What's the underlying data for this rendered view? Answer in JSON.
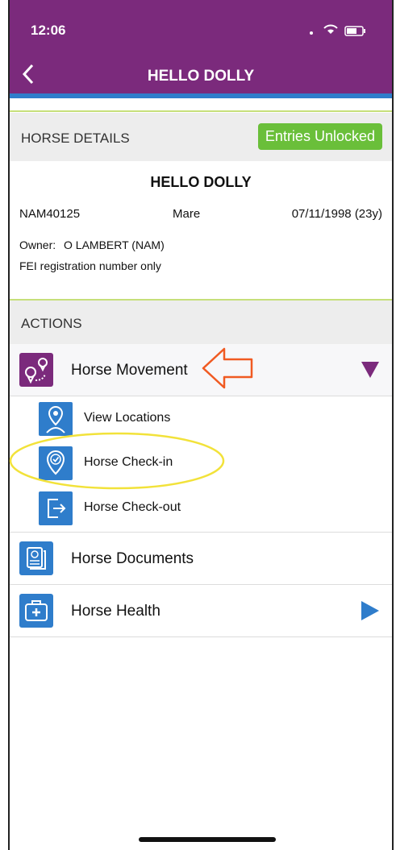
{
  "status": {
    "time": "12:06"
  },
  "nav": {
    "title": "HELLO DOLLY"
  },
  "details": {
    "section_label": "HORSE DETAILS",
    "badge": "Entries Unlocked",
    "horse_name": "HELLO DOLLY",
    "fei_id": "NAM40125",
    "sex": "Mare",
    "dob": "07/11/1998 (23y)",
    "owner_prefix": "Owner:",
    "owner": "O LAMBERT (NAM)",
    "registration_note": "FEI registration number only"
  },
  "actions": {
    "section_label": "ACTIONS",
    "movement": {
      "label": "Horse Movement",
      "icon": "location-route-icon",
      "sub_items": [
        {
          "label": "View Locations",
          "icon": "map-marker-person-icon"
        },
        {
          "label": "Horse Check-in",
          "icon": "location-check-icon"
        },
        {
          "label": "Horse Check-out",
          "icon": "exit-door-icon"
        }
      ]
    },
    "documents": {
      "label": "Horse Documents",
      "icon": "documents-icon"
    },
    "health": {
      "label": "Horse Health",
      "icon": "medical-kit-icon"
    }
  },
  "colors": {
    "header_purple": "#7b2a7c",
    "accent_blue": "#2f7dcb",
    "badge_green": "#6abf3a",
    "divider_green": "#c6df7a",
    "annotation_orange": "#f05a22",
    "annotation_yellow": "#f2e23a"
  }
}
